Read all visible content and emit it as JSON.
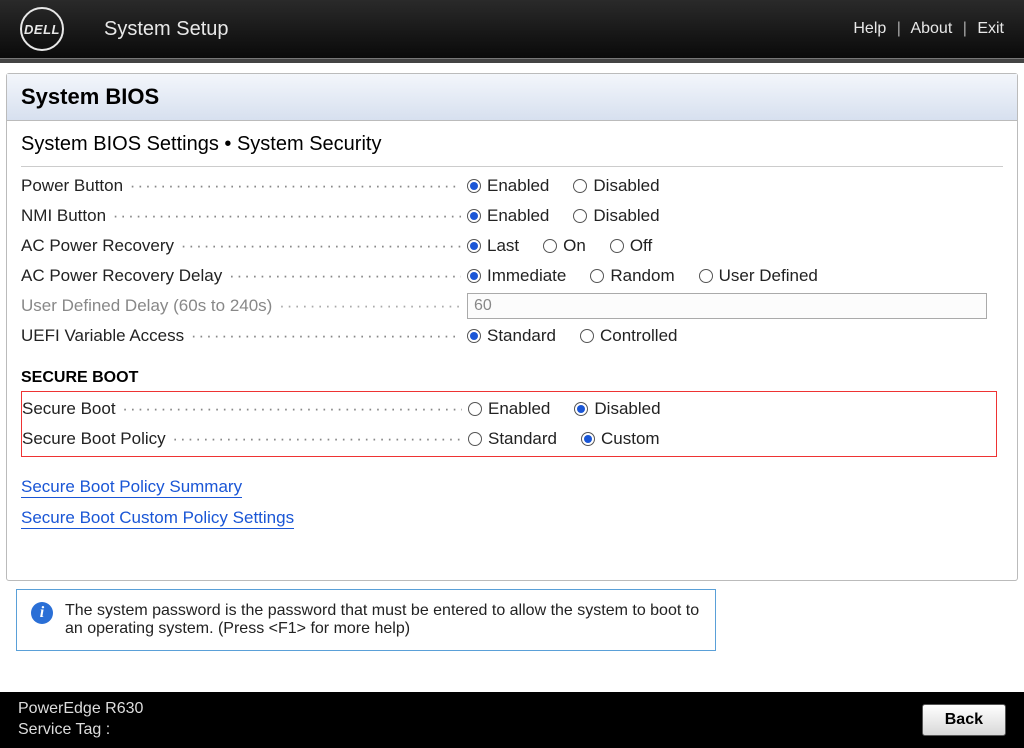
{
  "topbar": {
    "brand": "DELL",
    "title": "System Setup",
    "links": {
      "help": "Help",
      "about": "About",
      "exit": "Exit"
    }
  },
  "card": {
    "title": "System BIOS",
    "breadcrumb": "System BIOS Settings • System Security"
  },
  "settings": {
    "power_button": {
      "label": "Power Button",
      "options": [
        "Enabled",
        "Disabled"
      ],
      "selected": "Enabled"
    },
    "nmi_button": {
      "label": "NMI Button",
      "options": [
        "Enabled",
        "Disabled"
      ],
      "selected": "Enabled"
    },
    "ac_recovery": {
      "label": "AC Power Recovery",
      "options": [
        "Last",
        "On",
        "Off"
      ],
      "selected": "Last"
    },
    "ac_recovery_delay": {
      "label": "AC Power Recovery Delay",
      "options": [
        "Immediate",
        "Random",
        "User Defined"
      ],
      "selected": "Immediate"
    },
    "user_defined_delay": {
      "label": "User Defined Delay (60s to 240s)",
      "value": "60"
    },
    "uefi_var_access": {
      "label": "UEFI Variable Access",
      "options": [
        "Standard",
        "Controlled"
      ],
      "selected": "Standard"
    }
  },
  "secure_boot": {
    "section_title": "SECURE BOOT",
    "boot": {
      "label": "Secure Boot",
      "options": [
        "Enabled",
        "Disabled"
      ],
      "selected": "Disabled"
    },
    "policy": {
      "label": "Secure Boot Policy",
      "options": [
        "Standard",
        "Custom"
      ],
      "selected": "Custom"
    },
    "summary_link": "Secure Boot Policy Summary",
    "custom_link": "Secure Boot Custom Policy Settings"
  },
  "info": {
    "text": "The system password is the password that must be entered to allow the system to boot to an operating system. (Press <F1> for more help)"
  },
  "bottombar": {
    "model": "PowerEdge R630",
    "service_tag_label": "Service Tag :",
    "service_tag_value": "",
    "back": "Back"
  }
}
